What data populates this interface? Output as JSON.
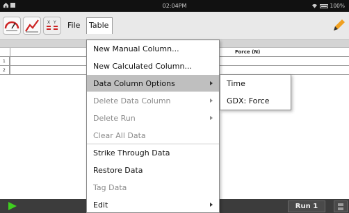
{
  "status_bar": {
    "time": "02:04PM",
    "battery": "100%"
  },
  "toolbar": {
    "menus": [
      {
        "label": "File"
      },
      {
        "label": "Table"
      }
    ],
    "icons": [
      "meter-icon",
      "graph-icon",
      "table-view-icon",
      "pencil-icon"
    ]
  },
  "table": {
    "column_headers": [
      "",
      "Force (N)"
    ],
    "rows": [
      {
        "num": "1"
      },
      {
        "num": "2"
      }
    ]
  },
  "table_menu": {
    "items": [
      {
        "label": "New Manual Column...",
        "enabled": true,
        "submenu": false
      },
      {
        "label": "New Calculated Column...",
        "enabled": true,
        "submenu": false
      },
      {
        "label": "Data Column Options",
        "enabled": true,
        "submenu": true,
        "active": true
      },
      {
        "label": "Delete Data Column",
        "enabled": false,
        "submenu": true
      },
      {
        "label": "Delete Run",
        "enabled": false,
        "submenu": true
      },
      {
        "label": "Clear All Data",
        "enabled": false,
        "submenu": false
      },
      {
        "label": "Strike Through Data",
        "enabled": true,
        "submenu": false
      },
      {
        "label": "Restore Data",
        "enabled": true,
        "submenu": false
      },
      {
        "label": "Tag Data",
        "enabled": false,
        "submenu": false
      },
      {
        "label": "Edit",
        "enabled": true,
        "submenu": true
      }
    ]
  },
  "data_column_submenu": {
    "items": [
      {
        "label": "Time"
      },
      {
        "label": "GDX: Force"
      }
    ]
  },
  "bottom_bar": {
    "run_label": "Run 1",
    "play_color": "#3fcf1f"
  }
}
